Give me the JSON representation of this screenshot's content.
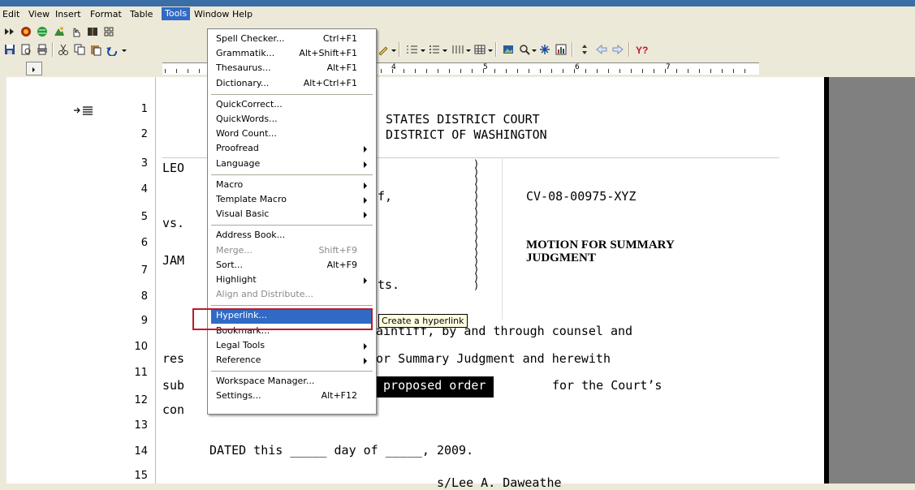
{
  "menubar": {
    "items": [
      "Edit",
      "View",
      "Insert",
      "Format",
      "Table",
      "Tools",
      "Window",
      "Help"
    ],
    "open_item": "Tools"
  },
  "tools_menu": {
    "groups": [
      [
        {
          "label": "Spell Checker...",
          "shortcut": "Ctrl+F1"
        },
        {
          "label": "Grammatik...",
          "shortcut": "Alt+Shift+F1"
        },
        {
          "label": "Thesaurus...",
          "shortcut": "Alt+F1"
        },
        {
          "label": "Dictionary...",
          "shortcut": "Alt+Ctrl+F1"
        }
      ],
      [
        {
          "label": "QuickCorrect..."
        },
        {
          "label": "QuickWords..."
        },
        {
          "label": "Word Count..."
        },
        {
          "label": "Proofread",
          "submenu": true
        },
        {
          "label": "Language",
          "submenu": true
        }
      ],
      [
        {
          "label": "Macro",
          "submenu": true
        },
        {
          "label": "Template Macro",
          "submenu": true
        },
        {
          "label": "Visual Basic",
          "submenu": true
        }
      ],
      [
        {
          "label": "Address Book..."
        },
        {
          "label": "Merge...",
          "shortcut": "Shift+F9",
          "disabled": true
        },
        {
          "label": "Sort...",
          "shortcut": "Alt+F9"
        },
        {
          "label": "Highlight",
          "submenu": true
        },
        {
          "label": "Align and Distribute...",
          "disabled": true
        }
      ],
      [
        {
          "label": "Hyperlink...",
          "selected": true
        },
        {
          "label": "Bookmark..."
        },
        {
          "label": "Legal Tools",
          "submenu": true
        },
        {
          "label": "Reference",
          "submenu": true
        }
      ],
      [
        {
          "label": "Workspace Manager..."
        },
        {
          "label": "Settings...",
          "shortcut": "Alt+F12"
        }
      ]
    ]
  },
  "tooltip": "Create a hyperlink",
  "ruler": {
    "numbers": [
      "4",
      "5",
      "6",
      "7"
    ]
  },
  "document": {
    "line_numbers": [
      "1",
      "2",
      "3",
      "4",
      "5",
      "6",
      "7",
      "8",
      "9",
      "10",
      "11",
      "12",
      "13",
      "14",
      "15"
    ],
    "court_line1": "STATES DISTRICT COURT",
    "court_line2": "DISTRICT OF WASHINGTON",
    "party1_fragment": "LEO",
    "party1_role_fragment": "f,",
    "vs": "vs.",
    "party2_fragment": "JAM",
    "party2_role_fragment": "ts.",
    "case_number": "CV-08-00975-XYZ",
    "motion_title_line1": "MOTION FOR SUMMARY",
    "motion_title_line2": "JUDGMENT",
    "body_line9": "aintiff, by and through counsel and",
    "body_line10_start": "res",
    "body_line10_rest": "or Summary Judgment and herewith",
    "body_line11_start": "sub",
    "body_line11_highlight": " proposed order ",
    "body_line11_rest": "for the Court’s",
    "body_line12_start": "con",
    "dated_line": "DATED this _____ day of _____, 2009.",
    "signature_fragment": "s/Lee A. Daweathe"
  },
  "colors": {
    "menu_highlight": "#316ac5",
    "tooltip_bg": "#ffffe1",
    "annotation_box": "#c0182a"
  }
}
